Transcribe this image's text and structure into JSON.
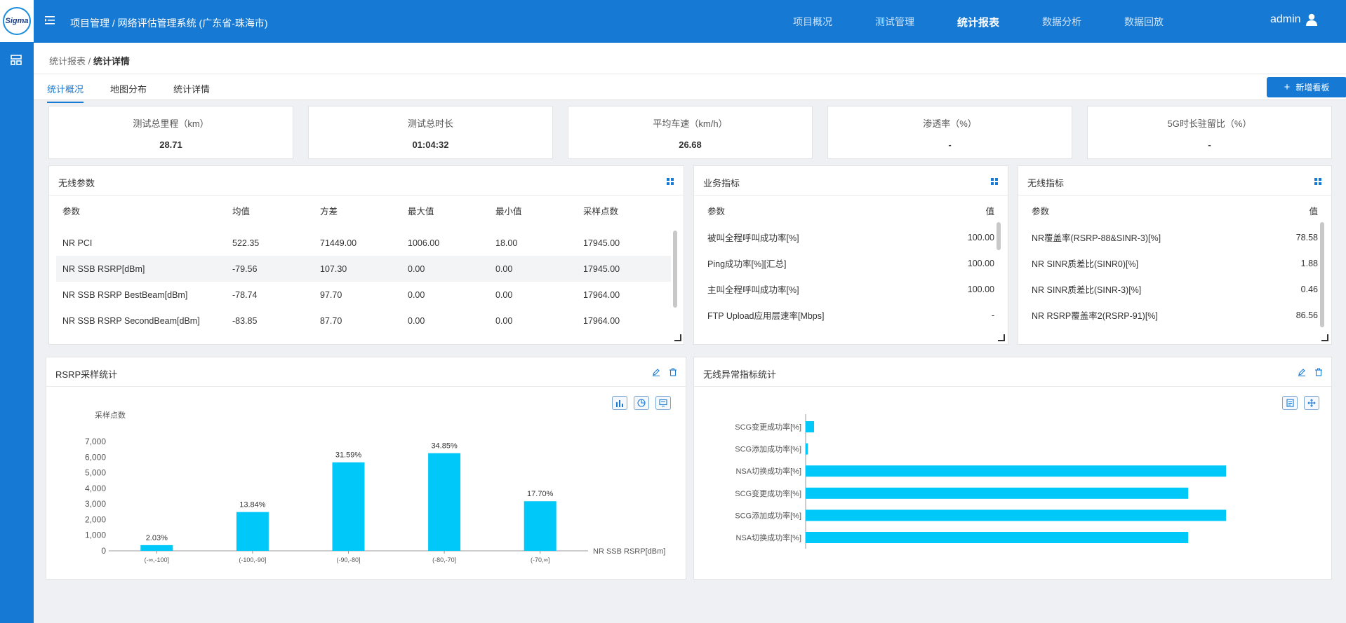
{
  "app": {
    "logo_text": "Sigma",
    "breadcrumb": "项目管理 / 网络评估管理系统 (广东省-珠海市)",
    "nav": [
      {
        "label": "项目概况",
        "active": false
      },
      {
        "label": "测试管理",
        "active": false
      },
      {
        "label": "统计报表",
        "active": true
      },
      {
        "label": "数据分析",
        "active": false
      },
      {
        "label": "数据回放",
        "active": false
      }
    ],
    "user": "admin"
  },
  "page": {
    "crumb_parent": "统计报表 / ",
    "crumb_current": "统计详情",
    "tabs": [
      {
        "label": "统计概况",
        "active": true
      },
      {
        "label": "地图分布",
        "active": false
      },
      {
        "label": "统计详情",
        "active": false
      }
    ],
    "add_button": "新增看板"
  },
  "cards": [
    {
      "title": "测试总里程（km）",
      "value": "28.71"
    },
    {
      "title": "测试总时长",
      "value": "01:04:32"
    },
    {
      "title": "平均车速（km/h）",
      "value": "26.68"
    },
    {
      "title": "渗透率（%）",
      "value": "-"
    },
    {
      "title": "5G时长驻留比（%）",
      "value": "-"
    }
  ],
  "wireless_params": {
    "title": "无线参数",
    "columns": [
      "参数",
      "均值",
      "方差",
      "最大值",
      "最小值",
      "采样点数"
    ],
    "rows": [
      [
        "NR PCI",
        "522.35",
        "71449.00",
        "1006.00",
        "18.00",
        "17945.00"
      ],
      [
        "NR SSB RSRP[dBm]",
        "-79.56",
        "107.30",
        "0.00",
        "0.00",
        "17945.00"
      ],
      [
        "NR SSB RSRP BestBeam[dBm]",
        "-78.74",
        "97.70",
        "0.00",
        "0.00",
        "17964.00"
      ],
      [
        "NR SSB RSRP SecondBeam[dBm]",
        "-83.85",
        "87.70",
        "0.00",
        "0.00",
        "17964.00"
      ]
    ]
  },
  "service_kpi": {
    "title": "业务指标",
    "columns": [
      "参数",
      "值"
    ],
    "rows": [
      [
        "被叫全程呼叫成功率[%]",
        "100.00"
      ],
      [
        "Ping成功率[%][汇总]",
        "100.00"
      ],
      [
        "主叫全程呼叫成功率[%]",
        "100.00"
      ],
      [
        "FTP Upload应用层速率[Mbps]",
        "-"
      ]
    ]
  },
  "wireless_kpi": {
    "title": "无线指标",
    "columns": [
      "参数",
      "值"
    ],
    "rows": [
      [
        "NR覆盖率(RSRP-88&SINR-3)[%]",
        "78.58"
      ],
      [
        "NR SINR质差比(SINR0)[%]",
        "1.88"
      ],
      [
        "NR SINR质差比(SINR-3)[%]",
        "0.46"
      ],
      [
        "NR RSRP覆盖率2(RSRP-91)[%]",
        "86.56"
      ]
    ]
  },
  "rsrp_panel": {
    "title": "RSRP采样统计"
  },
  "anomaly_panel": {
    "title": "无线异常指标统计"
  },
  "chart_data": [
    {
      "type": "bar",
      "ylabel": "采样点数",
      "xlabel": "NR SSB RSRP[dBm]",
      "categories": [
        "(-∞,-100]",
        "(-100,-90]",
        "(-90,-80]",
        "(-80,-70]",
        "(-70,∞]"
      ],
      "values": [
        364,
        2483,
        5667,
        6252,
        3175
      ],
      "data_labels": [
        "2.03%",
        "13.84%",
        "31.59%",
        "34.85%",
        "17.70%"
      ],
      "yticks": [
        "0",
        "1,000",
        "2,000",
        "3,000",
        "4,000",
        "5,000",
        "6,000",
        "7,000"
      ],
      "ylim": [
        0,
        7000
      ],
      "color": "#00c8f8"
    },
    {
      "type": "bar",
      "orientation": "horizontal",
      "categories": [
        "SCG变更成功率[%]",
        "SCG添加成功率[%]",
        "NSA切换成功率[%]",
        "SCG变更成功率[%]",
        "SCG添加成功率[%]",
        "NSA切换成功率[%]"
      ],
      "values": [
        2,
        0.5,
        100,
        91,
        100,
        91
      ],
      "xlim": [
        0,
        100
      ],
      "color": "#00c8f8"
    }
  ]
}
